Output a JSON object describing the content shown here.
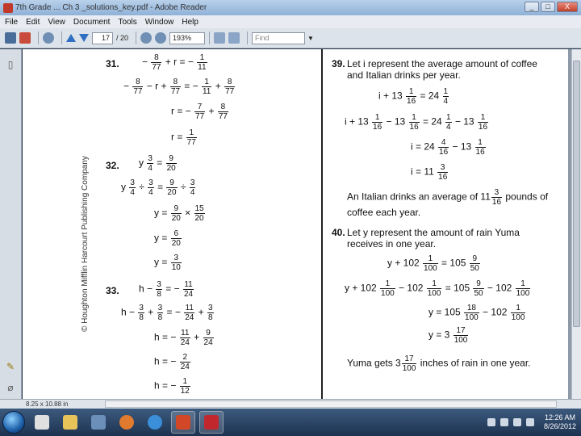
{
  "window": {
    "title": "7th Grade ... Ch 3 _solutions_key.pdf - Adobe Reader",
    "controls": [
      "_",
      "□",
      "X"
    ]
  },
  "menu": [
    "File",
    "Edit",
    "View",
    "Document",
    "Tools",
    "Window",
    "Help"
  ],
  "toolbar": {
    "page_current": "17",
    "page_total": "/ 20",
    "zoom": "193%",
    "find_placeholder": "Find"
  },
  "status": {
    "size": "8.25 x 10.88 in"
  },
  "taskbar": {
    "time": "12:26 AM",
    "date": "8/26/2012"
  },
  "page": {
    "publisher": "© Houghton Mifflin Harcourt Publishing Company",
    "p31": {
      "num": "31.",
      "l1": [
        "−",
        {
          "n": "8",
          "d": "77"
        },
        "+ r =",
        "−",
        {
          "n": "1",
          "d": "11"
        }
      ],
      "l2": [
        "−",
        {
          "n": "8",
          "d": "77"
        },
        "− r +",
        {
          "n": "8",
          "d": "77"
        },
        "=",
        "−",
        {
          "n": "1",
          "d": "11"
        },
        "+",
        {
          "n": "8",
          "d": "77"
        }
      ],
      "l3": [
        "r =",
        "−",
        {
          "n": "7",
          "d": "77"
        },
        "+",
        {
          "n": "8",
          "d": "77"
        }
      ],
      "l4": [
        "r =",
        {
          "n": "1",
          "d": "77"
        }
      ]
    },
    "p32": {
      "num": "32.",
      "l1": [
        "y",
        {
          "n": "3",
          "d": "4"
        },
        "=",
        {
          "n": "9",
          "d": "20"
        }
      ],
      "l2": [
        "y",
        {
          "n": "3",
          "d": "4"
        },
        "÷",
        {
          "n": "3",
          "d": "4"
        },
        "=",
        {
          "n": "9",
          "d": "20"
        },
        "÷",
        {
          "n": "3",
          "d": "4"
        }
      ],
      "l3": [
        "y =",
        {
          "n": "9",
          "d": "20"
        },
        "×",
        {
          "n": "15",
          "d": "20"
        }
      ],
      "l4": [
        "y =",
        {
          "n": "6",
          "d": "20"
        }
      ],
      "l5": [
        "y =",
        {
          "n": "3",
          "d": "10"
        }
      ]
    },
    "p33": {
      "num": "33.",
      "l1": [
        "h −",
        {
          "n": "3",
          "d": "8"
        },
        "=",
        "−",
        {
          "n": "11",
          "d": "24"
        }
      ],
      "l2": [
        "h −",
        {
          "n": "3",
          "d": "8"
        },
        "+",
        {
          "n": "3",
          "d": "8"
        },
        "=",
        "−",
        {
          "n": "11",
          "d": "24"
        },
        "+",
        {
          "n": "3",
          "d": "8"
        }
      ],
      "l3": [
        "h =",
        "−",
        {
          "n": "11",
          "d": "24"
        },
        "+",
        {
          "n": "9",
          "d": "24"
        }
      ],
      "l4": [
        "h =",
        "−",
        {
          "n": "2",
          "d": "24"
        }
      ],
      "l5": [
        "h =",
        "−",
        {
          "n": "1",
          "d": "12"
        }
      ]
    },
    "p39": {
      "num": "39.",
      "intro": "Let i represent the average amount of coffee and Italian drinks per year.",
      "l1": [
        "i + 13",
        {
          "n": "1",
          "d": "16"
        },
        "= 24",
        {
          "n": "1",
          "d": "4"
        }
      ],
      "l2": [
        "i + 13",
        {
          "n": "1",
          "d": "16"
        },
        "− 13",
        {
          "n": "1",
          "d": "16"
        },
        "= 24",
        {
          "n": "1",
          "d": "4"
        },
        "− 13",
        {
          "n": "1",
          "d": "16"
        }
      ],
      "l3": [
        "i = 24",
        {
          "n": "4",
          "d": "16"
        },
        "− 13",
        {
          "n": "1",
          "d": "16"
        }
      ],
      "l4": [
        "i = 11",
        {
          "n": "3",
          "d": "16"
        }
      ],
      "conclusion_a": "An Italian drinks an average of 11",
      "conclusion_frac": {
        "n": "3",
        "d": "16"
      },
      "conclusion_b": "pounds of",
      "conclusion_c": "coffee each year."
    },
    "p40": {
      "num": "40.",
      "intro": "Let y represent the amount of rain Yuma receives in one year.",
      "l1": [
        "y + 102",
        {
          "n": "1",
          "d": "100"
        },
        "= 105",
        {
          "n": "9",
          "d": "50"
        }
      ],
      "l2": [
        "y + 102",
        {
          "n": "1",
          "d": "100"
        },
        "− 102",
        {
          "n": "1",
          "d": "100"
        },
        "= 105",
        {
          "n": "9",
          "d": "50"
        },
        "− 102",
        {
          "n": "1",
          "d": "100"
        }
      ],
      "l3": [
        "y = 105",
        {
          "n": "18",
          "d": "100"
        },
        "− 102",
        {
          "n": "1",
          "d": "100"
        }
      ],
      "l4": [
        "y = 3",
        {
          "n": "17",
          "d": "100"
        }
      ],
      "conclusion_a": "Yuma gets 3",
      "conclusion_frac": {
        "n": "17",
        "d": "100"
      },
      "conclusion_b": "inches of rain in one year."
    }
  }
}
